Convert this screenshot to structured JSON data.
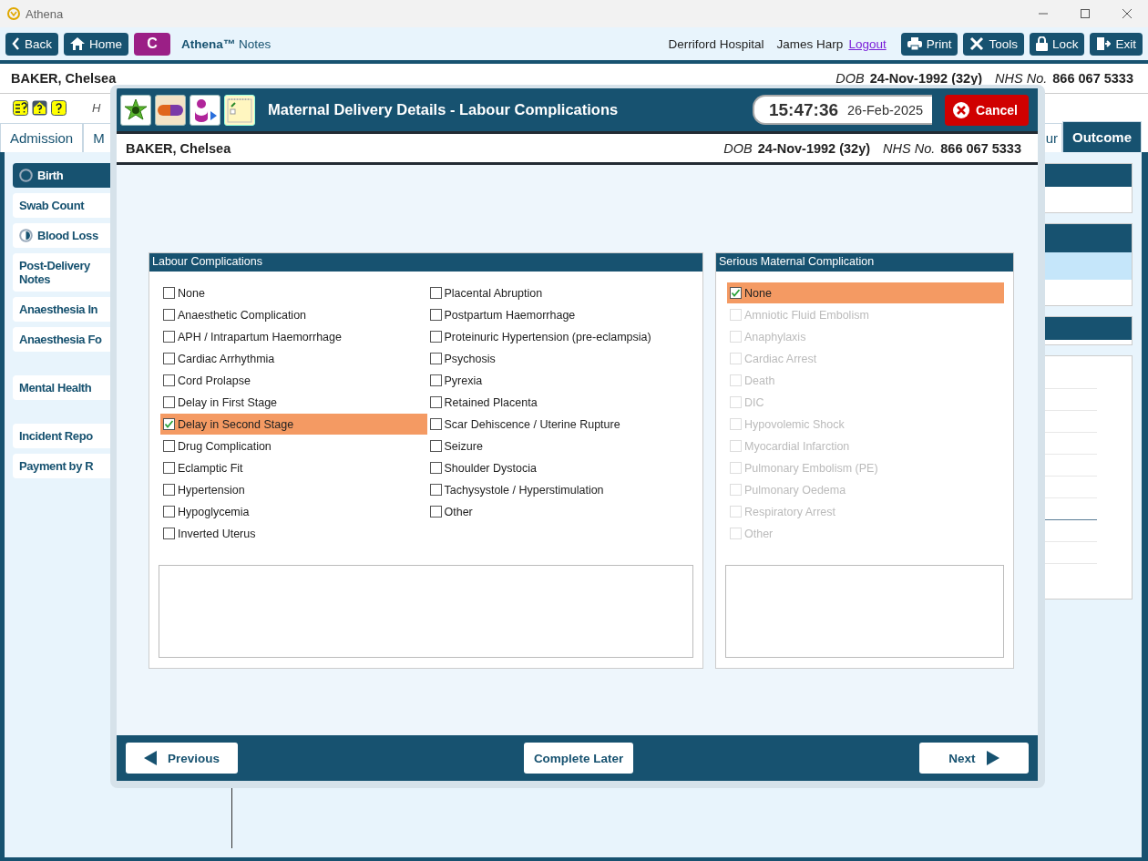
{
  "window": {
    "title": "Athena"
  },
  "toolbar": {
    "back": "Back",
    "home": "Home",
    "badge": "C",
    "app_name": "Athena™",
    "app_sub": "Notes",
    "hospital": "Derriford Hospital",
    "user": "James Harp",
    "logout": "Logout",
    "buttons": [
      "Print",
      "Tools",
      "Lock",
      "Exit"
    ]
  },
  "patient": {
    "name": "BAKER, Chelsea",
    "dob_label": "DOB",
    "dob": "24-Nov-1992 (32y)",
    "nhs_label": "NHS No.",
    "nhs": "866 067 5333"
  },
  "subheader_text": "H",
  "tabs": {
    "left": [
      {
        "label": "Admission",
        "selected": false
      },
      {
        "label": "M",
        "selected": false
      }
    ],
    "right": [
      {
        "label": "ur",
        "selected": false
      },
      {
        "label": "Outcome",
        "selected": true
      }
    ]
  },
  "sidebar": {
    "groups": [
      [
        {
          "label": "Birth",
          "selected": true,
          "kind": "ring"
        },
        {
          "label": "Swab Count",
          "selected": false,
          "kind": "plain"
        },
        {
          "label": "Blood Loss",
          "selected": false,
          "kind": "halfring"
        },
        {
          "label": "Post-Delivery Notes",
          "selected": false,
          "kind": "plain"
        },
        {
          "label": "Anaesthesia In",
          "selected": false,
          "kind": "plain"
        },
        {
          "label": "Anaesthesia Fo",
          "selected": false,
          "kind": "plain"
        }
      ],
      [
        {
          "label": "Mental Health",
          "selected": false,
          "kind": "plain"
        }
      ],
      [
        {
          "label": "Incident Repo",
          "selected": false,
          "kind": "plain"
        },
        {
          "label": "Payment by R",
          "selected": false,
          "kind": "plain"
        }
      ]
    ]
  },
  "dialog": {
    "title": "Maternal Delivery Details - Labour Complications",
    "time": "15:47:36",
    "date": "26-Feb-2025",
    "cancel": "Cancel",
    "patient": {
      "name": "BAKER, Chelsea",
      "dob_label": "DOB",
      "dob": "24-Nov-1992 (32y)",
      "nhs_label": "NHS No.",
      "nhs": "866 067 5333"
    },
    "labour": {
      "title": "Labour Complications",
      "columns": [
        [
          {
            "label": "None",
            "checked": false
          },
          {
            "label": "Anaesthetic Complication",
            "checked": false
          },
          {
            "label": "APH / Intrapartum Haemorrhage",
            "checked": false
          },
          {
            "label": "Cardiac Arrhythmia",
            "checked": false
          },
          {
            "label": "Cord Prolapse",
            "checked": false
          },
          {
            "label": "Delay in First Stage",
            "checked": false
          },
          {
            "label": "Delay in Second Stage",
            "checked": true
          },
          {
            "label": "Drug Complication",
            "checked": false
          },
          {
            "label": "Eclamptic Fit",
            "checked": false
          },
          {
            "label": "Hypertension",
            "checked": false
          },
          {
            "label": "Hypoglycemia",
            "checked": false
          },
          {
            "label": "Inverted Uterus",
            "checked": false
          }
        ],
        [
          {
            "label": "Placental Abruption",
            "checked": false
          },
          {
            "label": "Postpartum Haemorrhage",
            "checked": false
          },
          {
            "label": "Proteinuric Hypertension (pre-eclampsia)",
            "checked": false
          },
          {
            "label": "Psychosis",
            "checked": false
          },
          {
            "label": "Pyrexia",
            "checked": false
          },
          {
            "label": "Retained Placenta",
            "checked": false
          },
          {
            "label": "Scar Dehiscence / Uterine Rupture",
            "checked": false
          },
          {
            "label": "Seizure",
            "checked": false
          },
          {
            "label": "Shoulder Dystocia",
            "checked": false
          },
          {
            "label": "Tachysystole / Hyperstimulation",
            "checked": false
          },
          {
            "label": "Other",
            "checked": false
          }
        ]
      ]
    },
    "serious": {
      "title": "Serious Maternal Complication",
      "columns": [
        [
          {
            "label": "None",
            "checked": true,
            "disabled": false
          },
          {
            "label": "Amniotic Fluid Embolism",
            "checked": false,
            "disabled": true
          },
          {
            "label": "Anaphylaxis",
            "checked": false,
            "disabled": true
          },
          {
            "label": "Cardiac Arrest",
            "checked": false,
            "disabled": true
          },
          {
            "label": "Death",
            "checked": false,
            "disabled": true
          },
          {
            "label": "DIC",
            "checked": false,
            "disabled": true
          },
          {
            "label": "Hypovolemic Shock",
            "checked": false,
            "disabled": true
          },
          {
            "label": "Myocardial Infarction",
            "checked": false,
            "disabled": true
          },
          {
            "label": "Pulmonary Embolism (PE)",
            "checked": false,
            "disabled": true
          },
          {
            "label": "Pulmonary Oedema",
            "checked": false,
            "disabled": true
          },
          {
            "label": "Respiratory Arrest",
            "checked": false,
            "disabled": true
          },
          {
            "label": "Other",
            "checked": false,
            "disabled": true
          }
        ]
      ]
    },
    "previous": "Previous",
    "complete_later": "Complete Later",
    "next": "Next"
  }
}
